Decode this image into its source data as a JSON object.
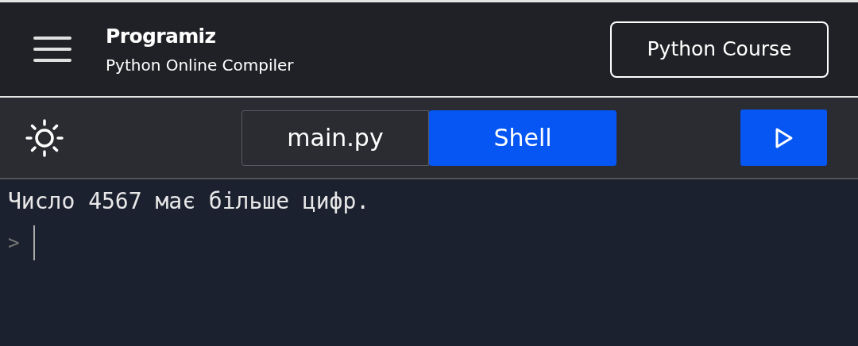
{
  "header": {
    "logo": "Programiz",
    "subtitle": "Python Online Compiler",
    "course_button": "Python Course"
  },
  "tabs": [
    {
      "label": "main.py",
      "selected": false
    },
    {
      "label": "Shell",
      "selected": true
    }
  ],
  "console": {
    "output": "Число 4567 має більше цифр.",
    "prompt": ">"
  }
}
